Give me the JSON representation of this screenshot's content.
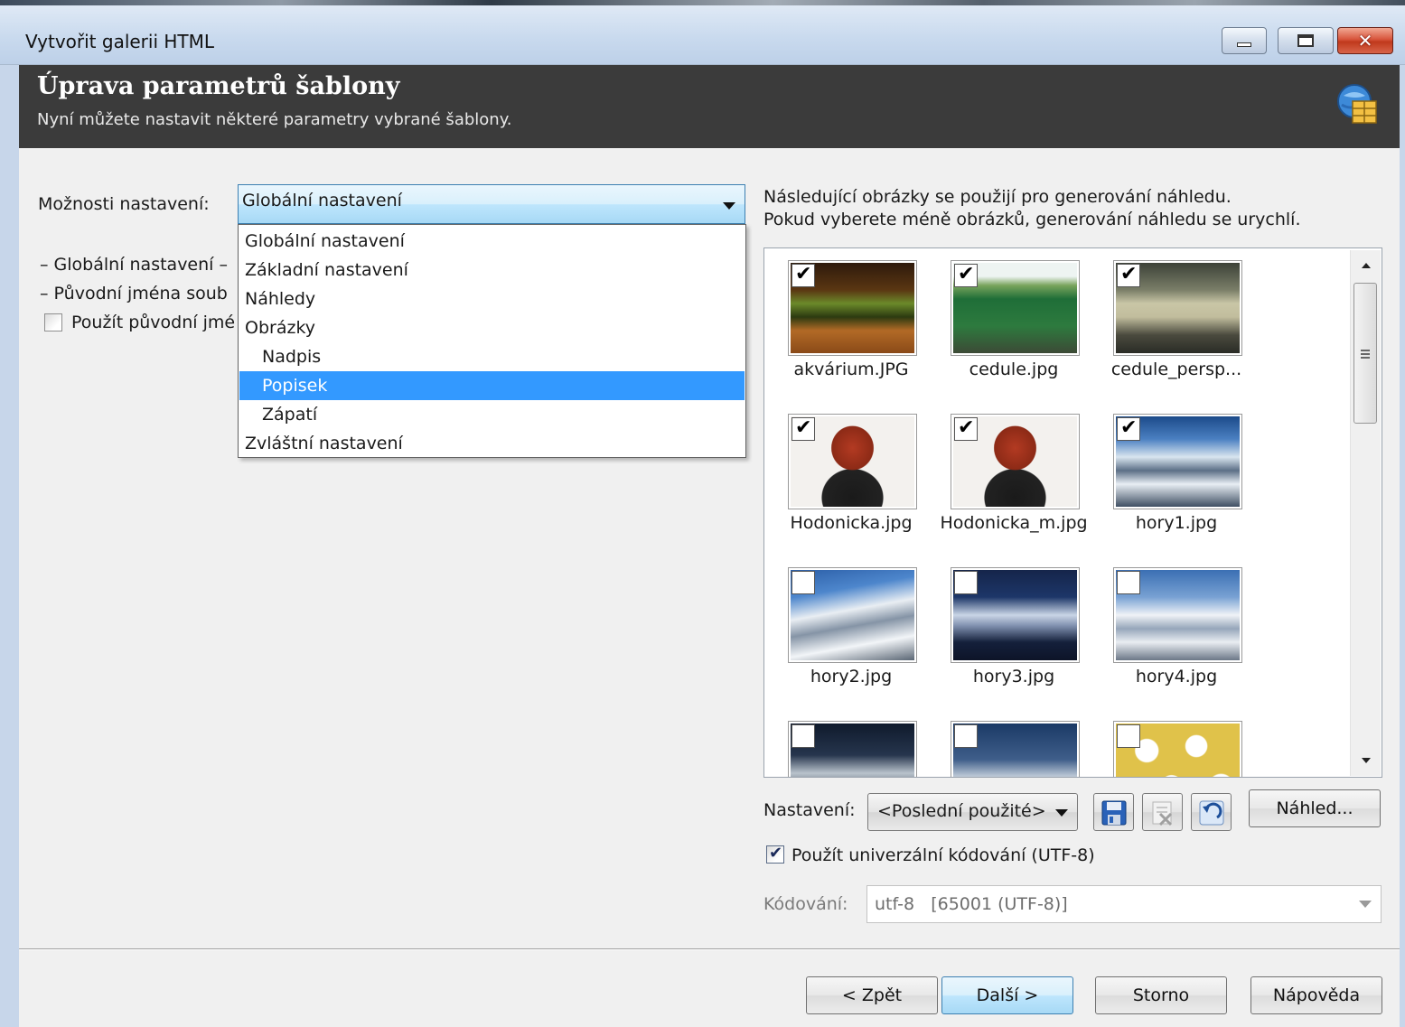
{
  "window": {
    "title": "Vytvořit galerii HTML",
    "buttons": {
      "minimize": "minimize-icon",
      "maximize": "maximize-icon",
      "close": "close-icon"
    }
  },
  "header": {
    "title": "Úprava parametrů šablony",
    "subtitle": "Nyní můžete nastavit některé parametry vybrané šablony.",
    "icon": "gallery-template-icon"
  },
  "left": {
    "options_label": "Možnosti nastavení:",
    "options_value": "Globální nastavení",
    "dropdown_items": [
      {
        "label": "Globální nastavení",
        "indent": false,
        "selected": false
      },
      {
        "label": "Základní nastavení",
        "indent": false,
        "selected": false
      },
      {
        "label": "Náhledy",
        "indent": false,
        "selected": false
      },
      {
        "label": "Obrázky",
        "indent": false,
        "selected": false
      },
      {
        "label": "Nadpis",
        "indent": true,
        "selected": false
      },
      {
        "label": "Popisek",
        "indent": true,
        "selected": true
      },
      {
        "label": "Zápatí",
        "indent": true,
        "selected": false
      },
      {
        "label": "Zvláštní nastavení",
        "indent": false,
        "selected": false
      }
    ],
    "group1": "Globální nastavení",
    "group2": "Původní jména soub",
    "use_original_names": "Použít původní jmé",
    "use_original_names_checked": false
  },
  "right": {
    "info_line1": "Následující obrázky se použijí pro generování náhledu.",
    "info_line2": "Pokud vyberete méně obrázků, generování náhledu se urychlí.",
    "images": [
      {
        "name": "akvárium.JPG",
        "checked": true
      },
      {
        "name": "cedule.jpg",
        "checked": true
      },
      {
        "name": "cedule_persp...",
        "checked": true
      },
      {
        "name": "Hodonicka.jpg",
        "checked": true
      },
      {
        "name": "Hodonicka_m.jpg",
        "checked": true
      },
      {
        "name": "hory1.jpg",
        "checked": true
      },
      {
        "name": "hory2.jpg",
        "checked": false
      },
      {
        "name": "hory3.jpg",
        "checked": false
      },
      {
        "name": "hory4.jpg",
        "checked": false
      },
      {
        "name": "",
        "checked": false
      },
      {
        "name": "",
        "checked": false
      },
      {
        "name": "",
        "checked": false
      }
    ],
    "preset_label": "Nastavení:",
    "preset_value": "<Poslední použité>",
    "preview_button": "Náhled...",
    "utf8_label": "Použít univerzální kódování (UTF-8)",
    "utf8_checked": true,
    "encoding_label": "Kódování:",
    "encoding_value": "utf-8   [65001 (UTF-8)]"
  },
  "footer": {
    "back": "< Zpět",
    "next": "Další >",
    "cancel": "Storno",
    "help": "Nápověda"
  }
}
